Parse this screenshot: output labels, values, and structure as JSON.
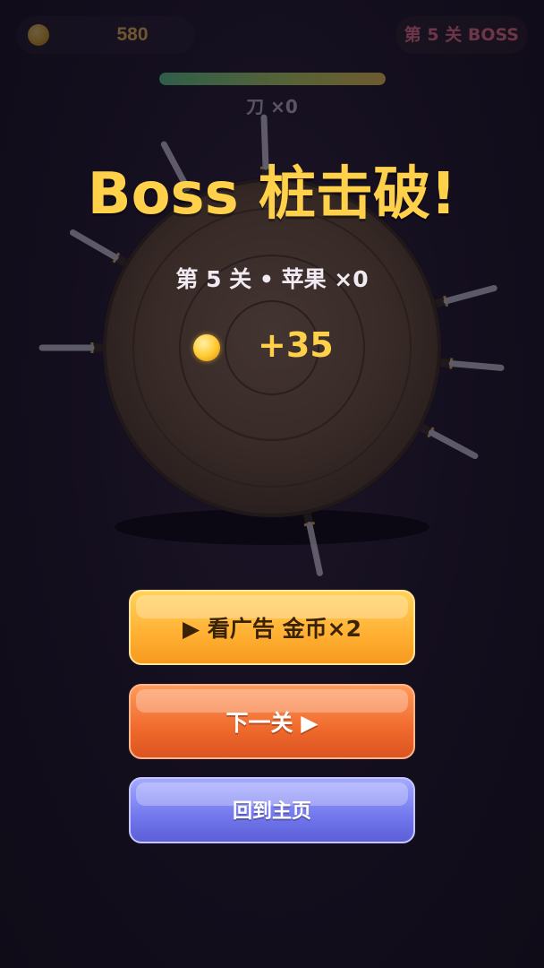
{
  "hud": {
    "coins": "580",
    "level_label": "第 5 关 BOSS",
    "progress": 1.0,
    "knife_count": "刀 ×0"
  },
  "result": {
    "title": "Boss 桩击破!",
    "subtitle": "第 5 关 • 苹果 ×0",
    "reward": "+35"
  },
  "buttons": {
    "watch_ad": "▶ 看广告 金币×2",
    "next_level": "下一关 ▶",
    "home": "回到主页"
  },
  "board": {
    "knife_count_stuck": 8
  },
  "colors": {
    "gold": "#ffd04a",
    "boss_red": "#ff7a92",
    "wood": "#5a4636"
  },
  "icons": [
    "coin-icon",
    "play-icon"
  ]
}
